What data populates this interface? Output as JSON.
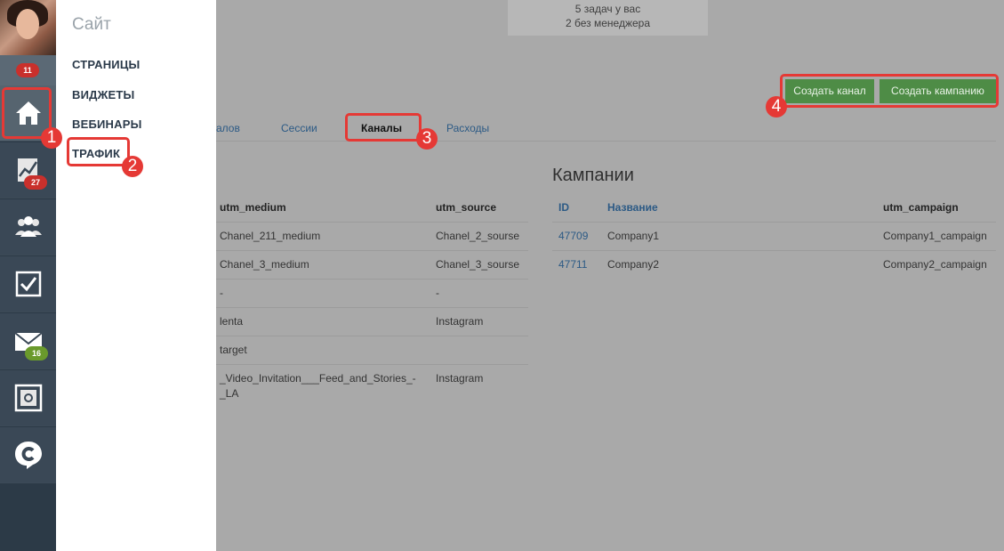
{
  "rail": {
    "avatar_badge": "11",
    "items": [
      {
        "icon": "home-icon",
        "badge": ""
      },
      {
        "icon": "chart-icon",
        "badge": "27"
      },
      {
        "icon": "users-icon",
        "badge": ""
      },
      {
        "icon": "checkbox-icon",
        "badge": ""
      },
      {
        "icon": "mail-icon",
        "badge": "16"
      },
      {
        "icon": "safe-icon",
        "badge": ""
      },
      {
        "icon": "chat-logo-icon",
        "badge": ""
      }
    ]
  },
  "sidemenu": {
    "title": "Сайт",
    "items": [
      "СТРАНИЦЫ",
      "ВИДЖЕТЫ",
      "ВЕБИНАРЫ",
      "ТРАФИК"
    ]
  },
  "tasks": {
    "line1": "5 задач у вас",
    "line2": "2 без менеджера"
  },
  "buttons": {
    "create_channel": "Создать канал",
    "create_campaign": "Создать кампанию"
  },
  "tabs": {
    "partial": "алов",
    "sessions": "Сессии",
    "channels": "Каналы",
    "expenses": "Расходы"
  },
  "channels_table": {
    "headers": [
      "utm_medium",
      "utm_source"
    ],
    "rows": [
      [
        "Chanel_211_medium",
        "Chanel_2_sourse"
      ],
      [
        "Chanel_3_medium",
        "Chanel_3_sourse"
      ],
      [
        "-",
        "-"
      ],
      [
        "lenta",
        "Instagram"
      ],
      [
        "target",
        ""
      ],
      [
        "_Video_Invitation___Feed_and_Stories_-",
        "Instagram"
      ]
    ],
    "row6_cont": "_LA"
  },
  "campaigns": {
    "title": "Кампании",
    "headers": [
      "ID",
      "Название",
      "utm_campaign"
    ],
    "rows": [
      [
        "47709",
        "Company1",
        "Company1_campaign"
      ],
      [
        "47711",
        "Company2",
        "Company2_campaign"
      ]
    ]
  },
  "markers": [
    "1",
    "2",
    "3",
    "4"
  ],
  "colors": {
    "overlay": "#a9a9a9",
    "rail": "#2c3a47",
    "button": "#4e8c46",
    "annotation": "#e53935",
    "link": "#2c5a85"
  }
}
